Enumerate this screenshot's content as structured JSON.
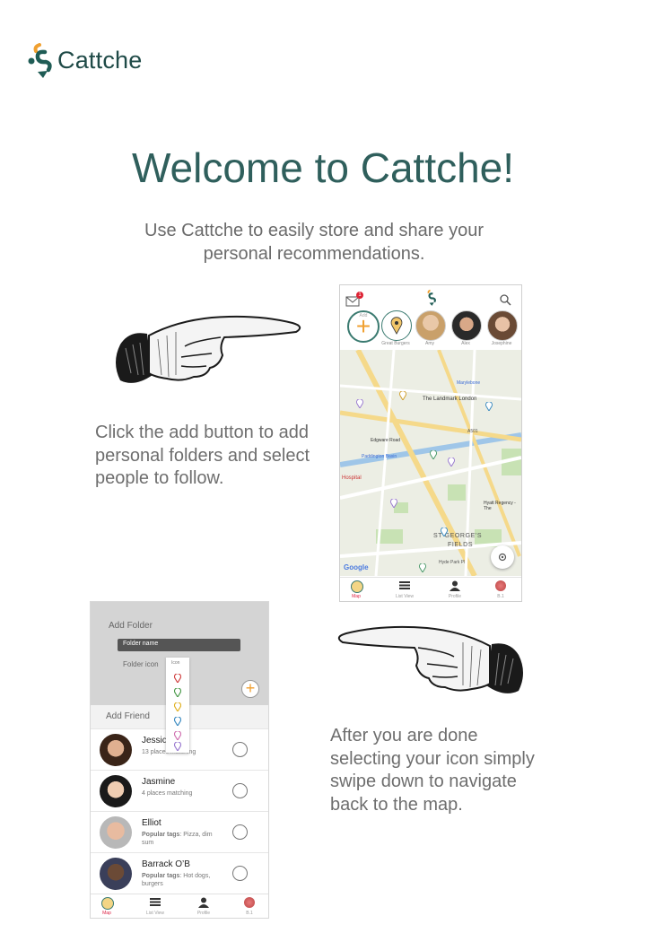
{
  "header": {
    "brand": "Cattche",
    "logo_icon": "cattche-logo-icon"
  },
  "hero": {
    "title": "Welcome to Cattche!",
    "subtitle_line1": "Use Cattche to easily store and share your",
    "subtitle_line2": "personal recommendations."
  },
  "steps": {
    "step1_text": "Click the add button to add personal folders and select people to follow.",
    "step2_text": "After you are done selecting your icon simply swipe down to navigate back to the map."
  },
  "phone_map": {
    "mail_badge": "1",
    "follow_items": [
      {
        "label": "Add"
      },
      {
        "label": "Great Burgers"
      },
      {
        "label": "Amy"
      },
      {
        "label": "Alex"
      },
      {
        "label": "Josephine"
      }
    ],
    "map_labels": [
      "Marylebone",
      "The Landmark London",
      "A501",
      "Edgware Road",
      "Paddington Basin",
      "Hospital",
      "Hyatt Regency - The",
      "ST GEORGE'S",
      "FIELDS",
      "Hyde Park Pl",
      "Google"
    ],
    "nav": [
      "Map",
      "List View",
      "Profile",
      "B.1"
    ]
  },
  "phone_folder": {
    "add_folder": "Add Folder",
    "folder_name_placeholder": "Folder name",
    "folder_icon_label": "Folder icon",
    "icon_dropdown_label": "Icon",
    "add_friend": "Add Friend",
    "friends": [
      {
        "name": "Jessica",
        "sub": "13 places matching"
      },
      {
        "name": "Jasmine",
        "sub": "4 places matching"
      },
      {
        "name": "Elliot",
        "tags_label": "Popular tags",
        "sub": ": Pizza, dim sum"
      },
      {
        "name": "Barrack O’B",
        "tags_label": "Popular tags",
        "sub": ": Hot dogs, burgers"
      }
    ],
    "nav": [
      "Map",
      "List View",
      "Profile",
      "B.1"
    ]
  },
  "colors": {
    "brand_teal": "#2f5f5c",
    "accent_orange": "#f0a030",
    "text_gray": "#6e6e6e"
  }
}
